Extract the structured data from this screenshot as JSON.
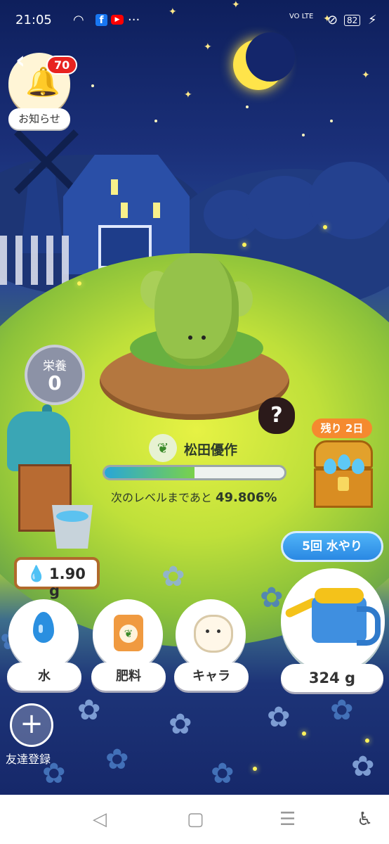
{
  "status_bar": {
    "time": "21:05",
    "fb_icon": "f",
    "right_icons": "VO LTE",
    "battery": "82"
  },
  "notifications": {
    "badge_count": "70",
    "label": "お知らせ"
  },
  "nutrition": {
    "label": "栄養",
    "value": "0"
  },
  "mystery_char": "?",
  "player": {
    "name": "松田優作",
    "leaf_icon": "🌱",
    "progress_fraction": 0.49806,
    "level_text_prefix": "次のレベルまであと",
    "level_percent": "49.806%"
  },
  "water_stock": {
    "value": "1.90 g"
  },
  "treasure": {
    "remaining_label": "残り 2日"
  },
  "watering": {
    "button_label": "5回 水やり",
    "amount": "324 g"
  },
  "bottom_actions": [
    {
      "label": "水"
    },
    {
      "label": "肥料"
    },
    {
      "label": "キャラ"
    }
  ],
  "friends": {
    "plus": "+",
    "label": "友達登録"
  },
  "nav": {
    "back": "◁",
    "home": "▢",
    "menu": "☰",
    "accessibility": "♿"
  },
  "colors": {
    "accent_blue": "#2a88e3",
    "badge_red": "#e8231f",
    "chest_orange": "#f58a2f"
  }
}
